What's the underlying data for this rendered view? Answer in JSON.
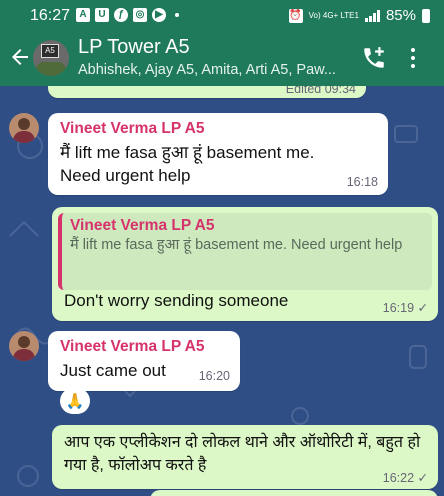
{
  "status_bar": {
    "time": "16:27",
    "notification_icons": [
      "A",
      "U",
      "ƒ",
      "◎",
      "▶"
    ],
    "network": "Vo) 4G+ LTE1",
    "battery": "85%"
  },
  "header": {
    "title": "LP Tower A5",
    "participants": "Abhishek, Ajay A5, Amita, Arti A5, Paw...",
    "avatar_sign": "A5"
  },
  "messages": [
    {
      "type": "partial",
      "meta": "Edited 09:34"
    },
    {
      "type": "incoming",
      "sender": "Vineet Verma LP A5",
      "text": "मैं lift me fasa हुआ हूं basement me. Need urgent help",
      "time": "16:18"
    },
    {
      "type": "outgoing",
      "quote_sender": "Vineet Verma LP A5",
      "quote_text": "मैं lift me fasa हुआ हूं basement me. Need urgent help",
      "text": "Don't worry sending someone",
      "time": "16:19",
      "status": "✓"
    },
    {
      "type": "incoming",
      "sender": "Vineet Verma LP A5",
      "text": "Just came out",
      "time": "16:20",
      "reaction": "🙏"
    },
    {
      "type": "outgoing",
      "text": "आप एक एप्लीकेशन दो लोकल थाने और ऑथोरिटी में, बहुत हो गया है, फॉलोअप करते है",
      "time": "16:22",
      "status": "✓"
    }
  ],
  "colors": {
    "header": "#1f7a5c",
    "chat_background": "#2f4e86",
    "incoming_bubble": "#ffffff",
    "outgoing_bubble": "#dcf8c6",
    "sender_name": "#d6336c"
  }
}
